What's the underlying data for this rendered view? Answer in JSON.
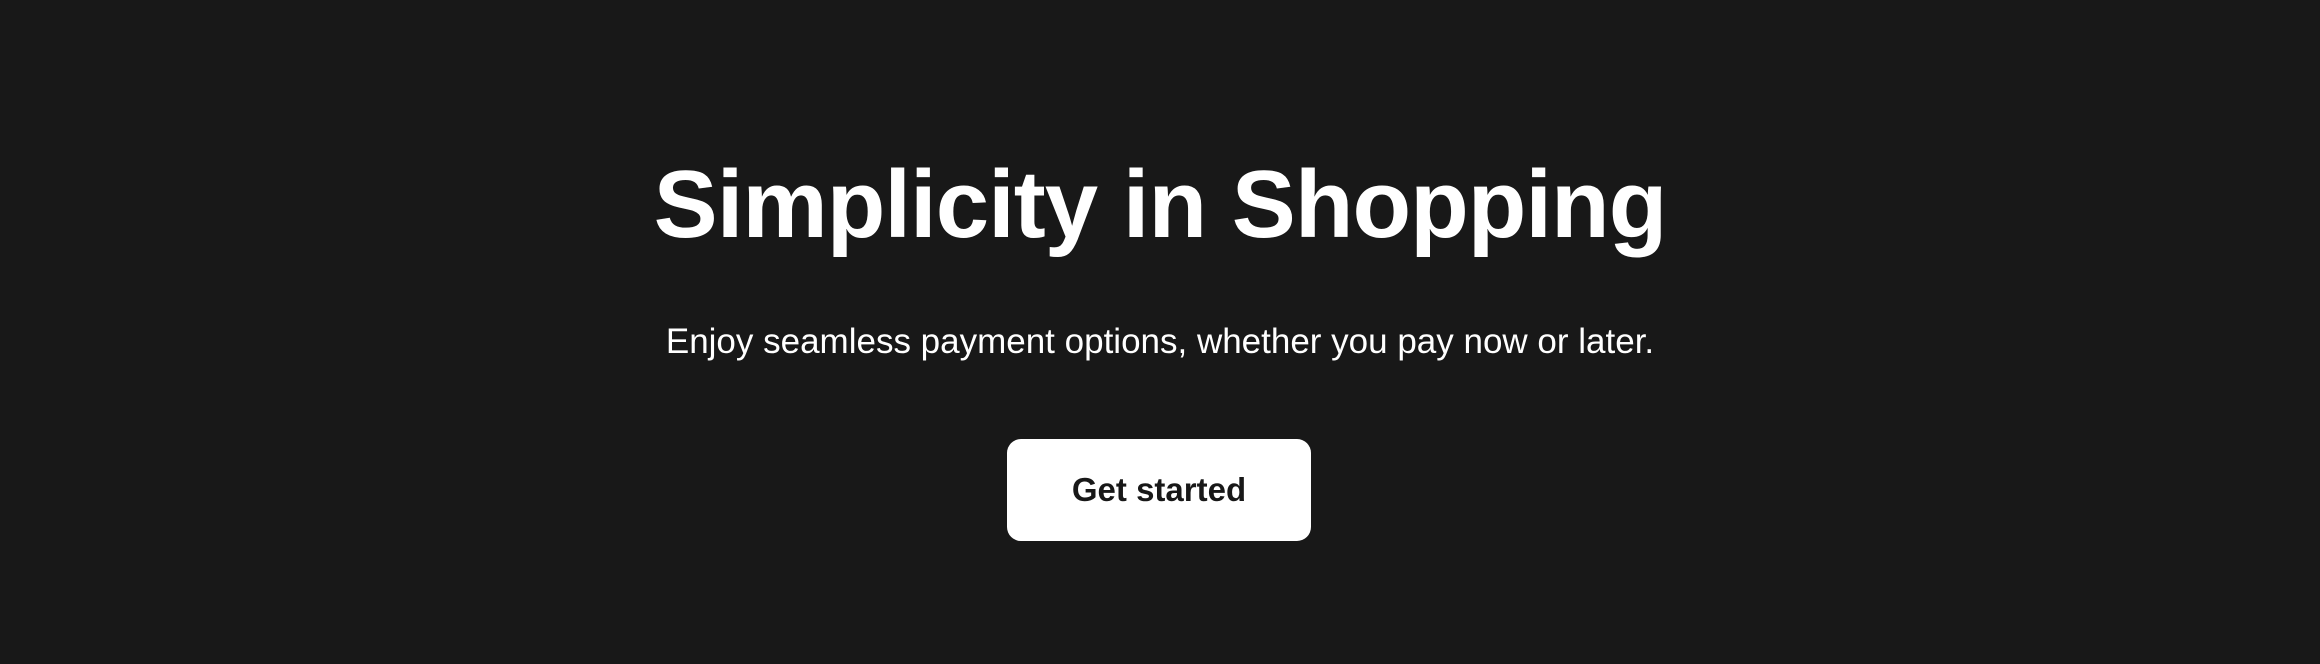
{
  "hero": {
    "title": "Simplicity in Shopping",
    "subtitle": "Enjoy seamless payment options, whether you pay now or later.",
    "cta_label": "Get started"
  },
  "colors": {
    "background": "#181818",
    "text": "#ffffff",
    "button_background": "#ffffff",
    "button_text": "#181818"
  }
}
